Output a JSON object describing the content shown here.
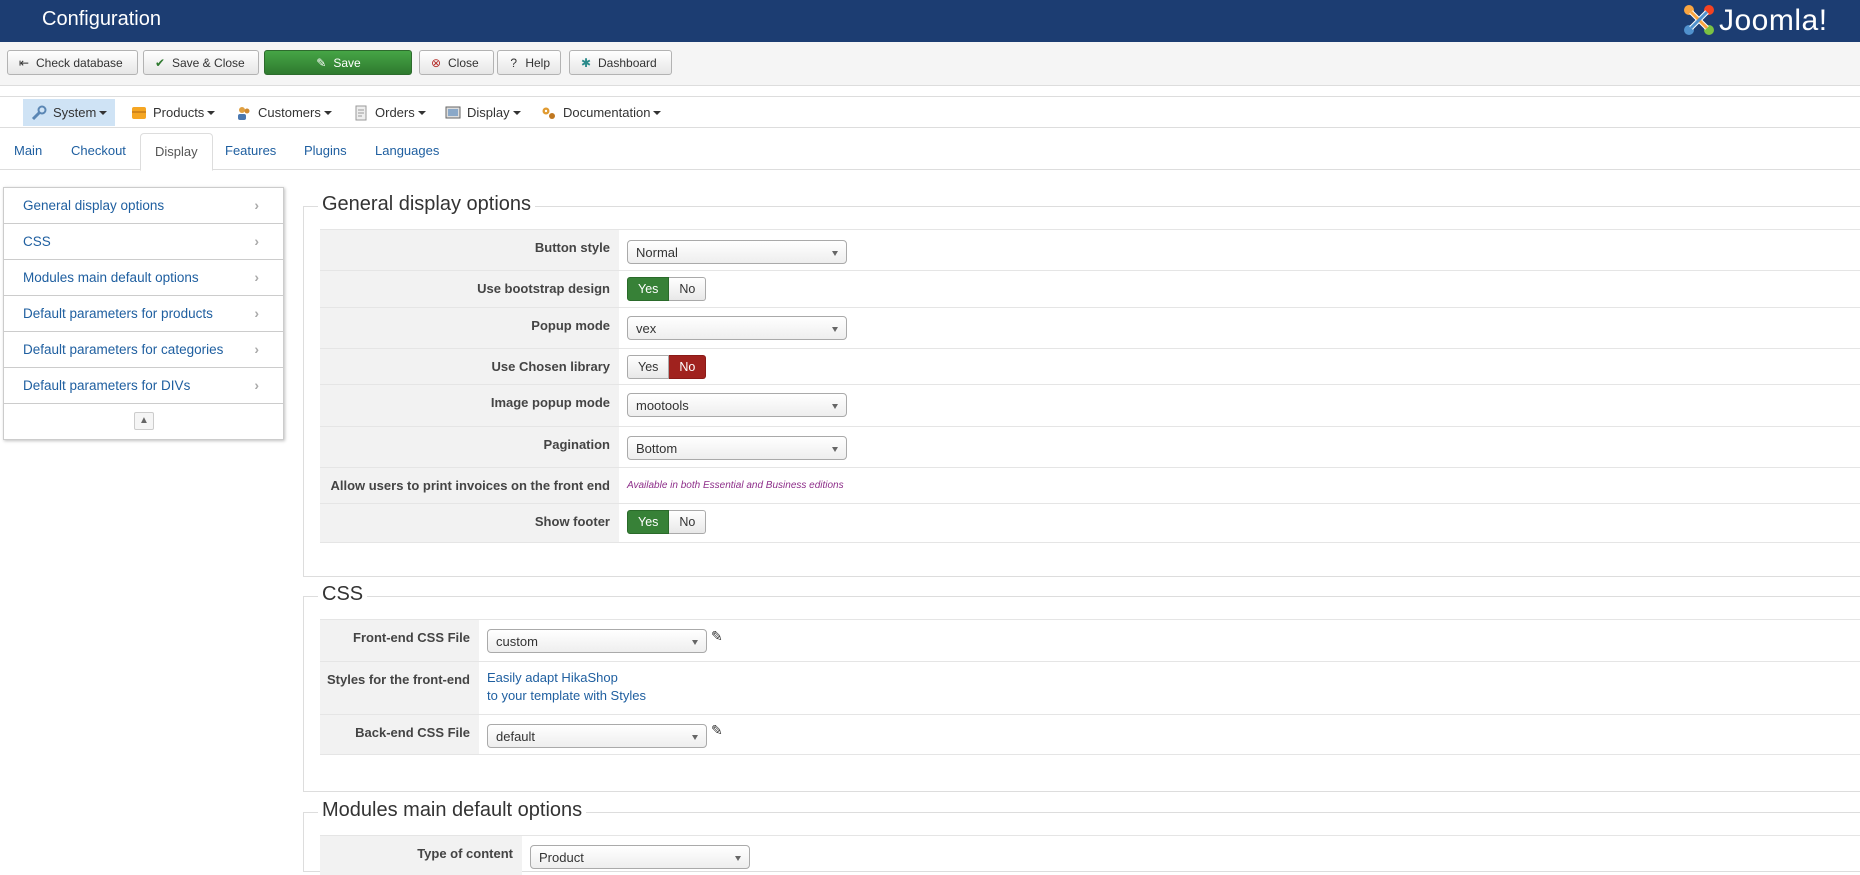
{
  "header": {
    "title": "Configuration",
    "logo_text": "Joomla!"
  },
  "toolbar": {
    "check_database": "Check database",
    "save_close": "Save & Close",
    "save": "Save",
    "close": "Close",
    "help": "Help",
    "dashboard": "Dashboard"
  },
  "menu": {
    "items": [
      {
        "label": "System",
        "icon": "wrench-icon"
      },
      {
        "label": "Products",
        "icon": "box-icon"
      },
      {
        "label": "Customers",
        "icon": "users-icon"
      },
      {
        "label": "Orders",
        "icon": "orders-icon"
      },
      {
        "label": "Display",
        "icon": "display-icon"
      },
      {
        "label": "Documentation",
        "icon": "gears-icon"
      }
    ]
  },
  "tabs": [
    "Main",
    "Checkout",
    "Display",
    "Features",
    "Plugins",
    "Languages"
  ],
  "active_tab": "Display",
  "sidebar": {
    "items": [
      "General display options",
      "CSS",
      "Modules main default options",
      "Default parameters for products",
      "Default parameters for categories",
      "Default parameters for DIVs"
    ]
  },
  "general": {
    "title": "General display options",
    "button_style": {
      "label": "Button style",
      "value": "Normal"
    },
    "bootstrap": {
      "label": "Use bootstrap design",
      "yes": "Yes",
      "no": "No",
      "selected": "Yes"
    },
    "popup_mode": {
      "label": "Popup mode",
      "value": "vex"
    },
    "chosen": {
      "label": "Use Chosen library",
      "yes": "Yes",
      "no": "No",
      "selected": "No"
    },
    "image_popup": {
      "label": "Image popup mode",
      "value": "mootools"
    },
    "pagination": {
      "label": "Pagination",
      "value": "Bottom"
    },
    "print_invoices": {
      "label": "Allow users to print invoices on the front end",
      "note": "Available in both Essential and Business editions"
    },
    "show_footer": {
      "label": "Show footer",
      "yes": "Yes",
      "no": "No",
      "selected": "Yes"
    }
  },
  "css": {
    "title": "CSS",
    "frontend": {
      "label": "Front-end CSS File",
      "value": "custom"
    },
    "styles": {
      "label": "Styles for the front-end",
      "line1": "Easily adapt HikaShop",
      "line2": "to your template with Styles"
    },
    "backend": {
      "label": "Back-end CSS File",
      "value": "default"
    }
  },
  "modules": {
    "title": "Modules main default options",
    "type_content": {
      "label": "Type of content",
      "value": "Product"
    }
  },
  "colors": {
    "header_bg": "#1c3d72",
    "save_green": "#378137",
    "no_red": "#a0221e",
    "link": "#1f5fa0"
  }
}
